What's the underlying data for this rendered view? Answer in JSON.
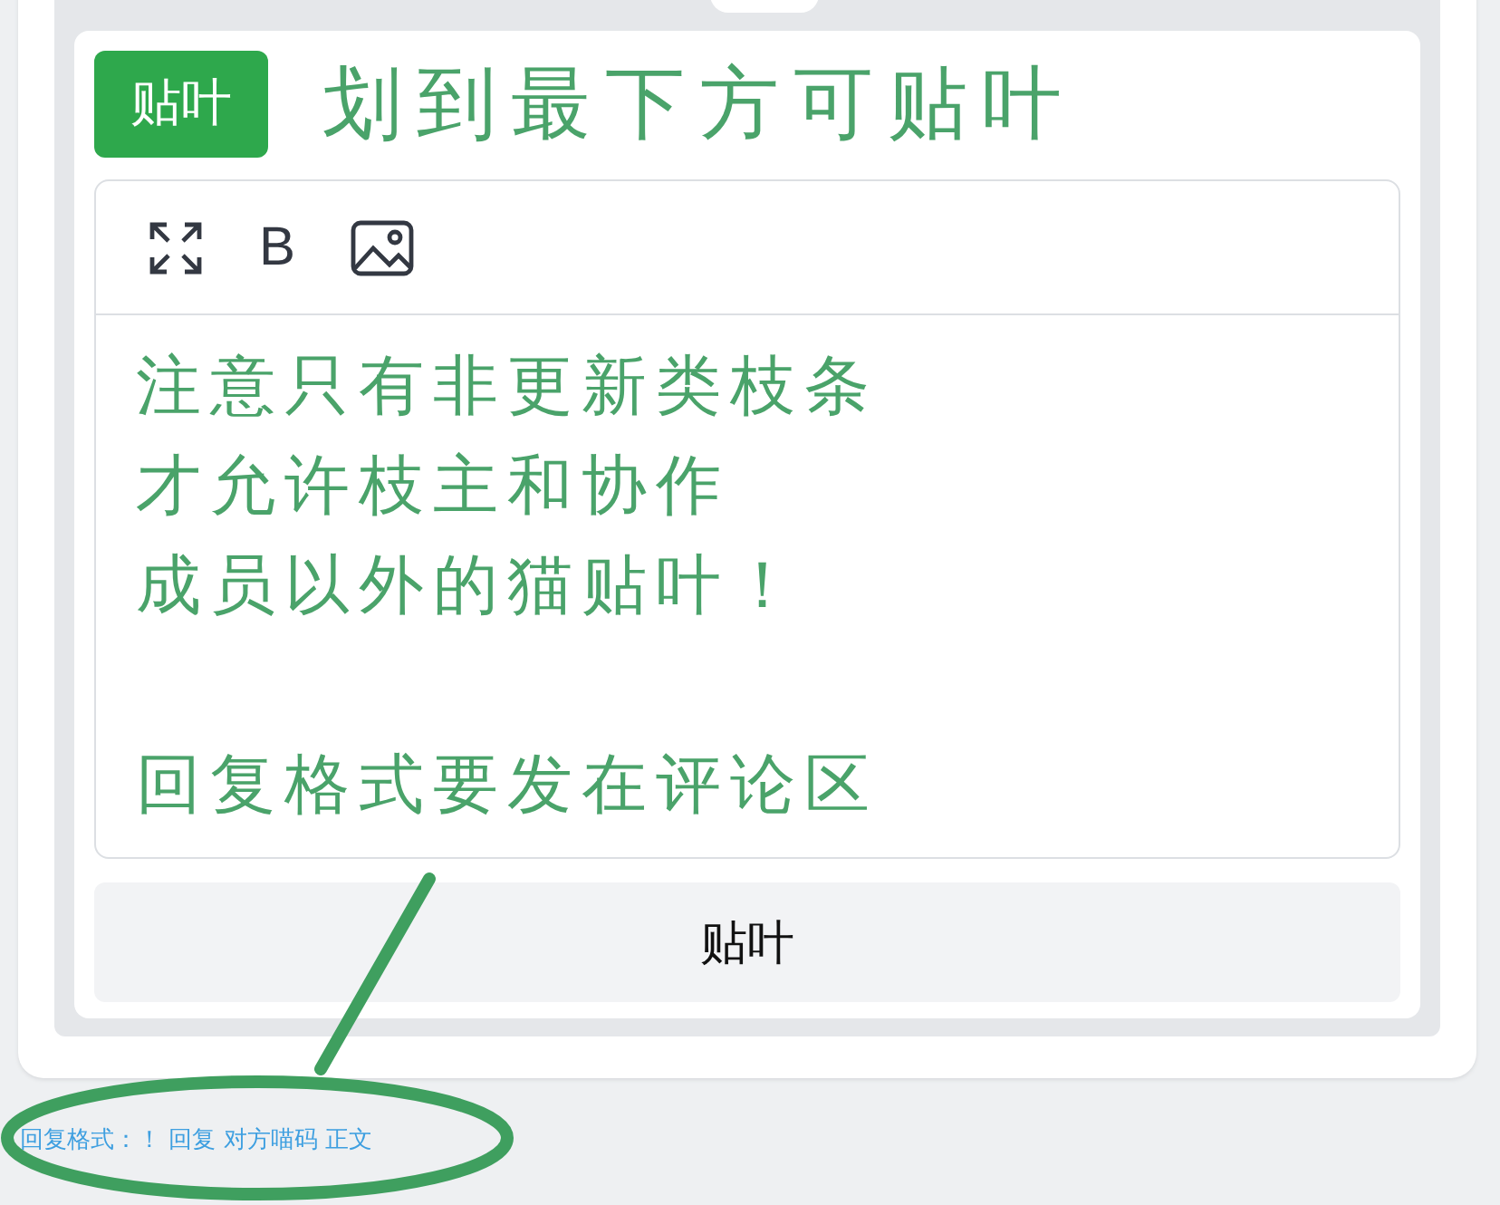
{
  "post_button": {
    "label": "贴叶"
  },
  "annotation_title": "划到最下方可贴叶",
  "editor": {
    "tools": [
      {
        "kind": "expand"
      },
      {
        "kind": "bold",
        "label": "B"
      },
      {
        "kind": "image"
      }
    ],
    "annotation_paragraphs": [
      [
        "注意只有非更新类枝条",
        "才允许枝主和协作",
        "成员以外的猫贴叶！"
      ],
      [
        "回复格式要发在评论区"
      ]
    ]
  },
  "submit_button": {
    "label": "贴叶"
  },
  "reply_hint": "回复格式：！ 回复 对方喵码 正文"
}
